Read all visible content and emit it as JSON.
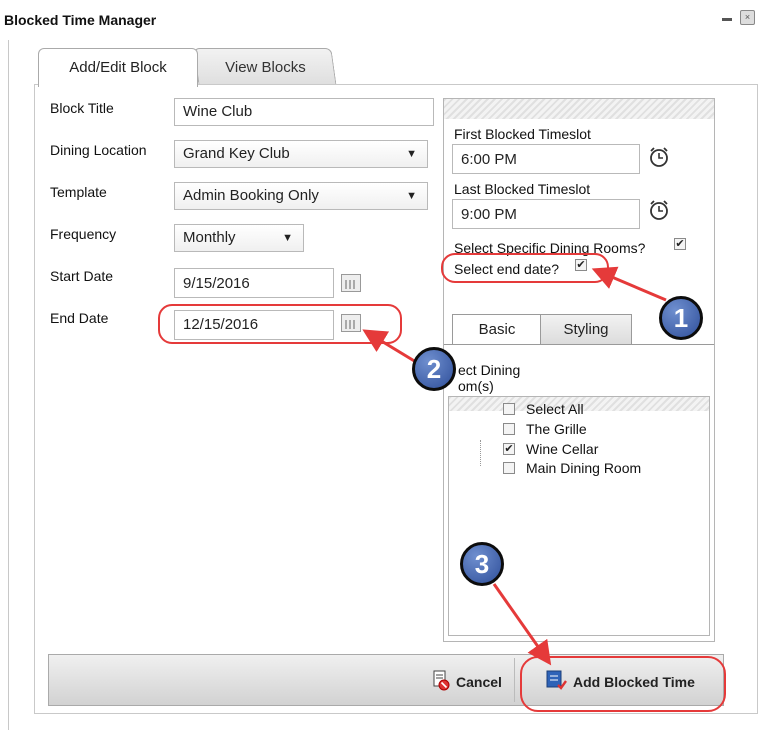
{
  "window": {
    "title": "Blocked Time Manager"
  },
  "tabs": [
    {
      "label": "Add/Edit Block"
    },
    {
      "label": "View Blocks"
    }
  ],
  "form": {
    "block_title": {
      "label": "Block Title",
      "value": "Wine Club"
    },
    "dining_location": {
      "label": "Dining Location",
      "value": "Grand Key Club"
    },
    "template": {
      "label": "Template",
      "value": "Admin Booking Only"
    },
    "frequency": {
      "label": "Frequency",
      "value": "Monthly"
    },
    "start_date": {
      "label": "Start Date",
      "value": "9/15/2016"
    },
    "end_date": {
      "label": "End Date",
      "value": "12/15/2016"
    }
  },
  "right_panel": {
    "first_timeslot": {
      "label": "First Blocked Timeslot",
      "value": "6:00 PM"
    },
    "last_timeslot": {
      "label": "Last Blocked Timeslot",
      "value": "9:00 PM"
    },
    "select_rooms": {
      "label": "Select Specific Dining Rooms?",
      "checked": true
    },
    "select_end_date": {
      "label": "Select end date?",
      "checked": true
    },
    "subtabs": [
      {
        "label": "Basic"
      },
      {
        "label": "Styling"
      }
    ],
    "rooms_heading_line1": "ect Dining",
    "rooms_heading_line2": "om(s)",
    "rooms": [
      {
        "label": "Select All",
        "checked": false
      },
      {
        "label": "The Grille",
        "checked": false
      },
      {
        "label": "Wine Cellar",
        "checked": true
      },
      {
        "label": "Main Dining Room",
        "checked": false
      }
    ]
  },
  "footer": {
    "cancel_label": "Cancel",
    "add_label": "Add Blocked Time"
  },
  "annotations": [
    {
      "number": "1"
    },
    {
      "number": "2"
    },
    {
      "number": "3"
    }
  ],
  "colors": {
    "annotation_red": "#e53a3a",
    "badge_blue": "#3b5ea8"
  },
  "icons": [
    "calendar-icon",
    "clock-icon",
    "cancel-icon",
    "add-blocked-time-icon",
    "minimize-icon",
    "maximize-icon"
  ]
}
